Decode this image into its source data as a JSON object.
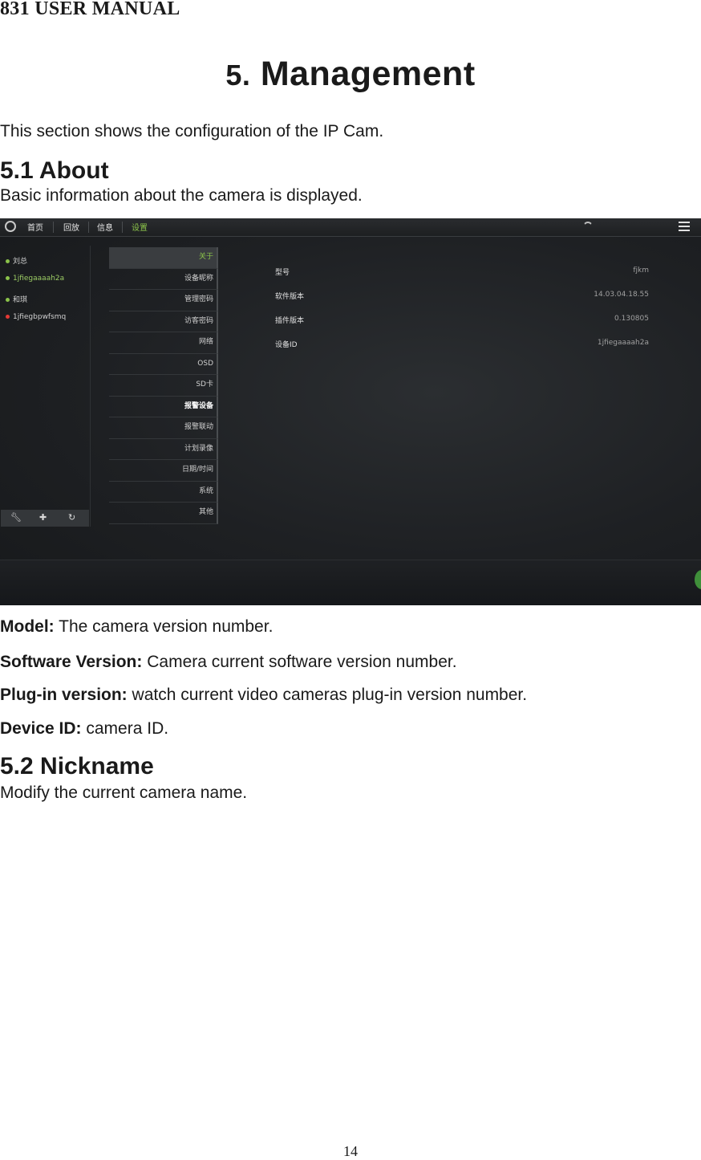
{
  "header": {
    "manual_title": "831 USER MANUAL"
  },
  "section": {
    "number": "5.",
    "title": "Management",
    "intro": "This section shows the configuration of the IP Cam."
  },
  "about": {
    "heading": "5.1 About",
    "description": "Basic information about the camera is displayed.",
    "definitions": [
      {
        "term": "Model:",
        "text": " The camera version number."
      },
      {
        "term": "Software Version:",
        "text": " Camera current software version number."
      },
      {
        "term": "Plug-in version:",
        "text": " watch current video cameras plug-in version number."
      },
      {
        "term": "Device ID:",
        "text": " camera ID."
      }
    ]
  },
  "nickname": {
    "heading": "5.2 Nickname",
    "description": "Modify the current camera name."
  },
  "screenshot": {
    "nav": [
      "首页",
      "回放",
      "信息",
      "设置"
    ],
    "active_nav": "设置",
    "devices": [
      {
        "name": "刘总",
        "dot": "#8bc34a"
      },
      {
        "name": "1jfiegaaaah2a",
        "dot": "#8bc34a"
      },
      {
        "name": "和琪",
        "dot": "#8bc34a"
      },
      {
        "name": "1jfiegbpwfsmq",
        "dot": "#e53935"
      }
    ],
    "settings_menu": [
      "关于",
      "设备昵称",
      "管理密码",
      "访客密码",
      "网络",
      "OSD",
      "SD卡",
      "报警设备",
      "报警联动",
      "计划录像",
      "日期/时间",
      "系统",
      "其他"
    ],
    "info": [
      {
        "label": "型号",
        "value": "fjkm"
      },
      {
        "label": "软件版本",
        "value": "14.03.04.18.55"
      },
      {
        "label": "插件版本",
        "value": "0.130805"
      },
      {
        "label": "设备ID",
        "value": "1jfiegaaaah2a"
      }
    ],
    "tools": [
      "wrench-icon",
      "plus-icon",
      "refresh-icon"
    ]
  },
  "footer": {
    "page_number": "14"
  }
}
